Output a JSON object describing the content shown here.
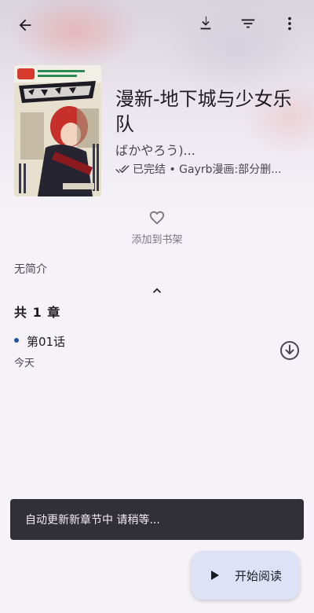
{
  "toolbar": {
    "back_icon": "arrow-back-icon",
    "download_icon": "download-icon",
    "filter_icon": "filter-icon",
    "more_icon": "more-vert-icon"
  },
  "manga": {
    "cover_icon": "manga-cover-image",
    "title": "漫新-地下城与少女乐队",
    "author": "ばかやろう)...",
    "status_icon": "done-all-icon",
    "status_text": "已完结 • Gayrb漫画:部分删..."
  },
  "actions": {
    "favorite_icon": "heart-outline-icon",
    "favorite_label": "添加到书架"
  },
  "description": {
    "text": "无简介",
    "collapse_icon": "chevron-up-icon"
  },
  "chapters": {
    "count_label": "共 1 章",
    "items": [
      {
        "title": "第01话",
        "date": "今天",
        "download_icon": "download-circle-icon"
      }
    ]
  },
  "snackbar": {
    "text": "自动更新新章节中 请稍等..."
  },
  "fab": {
    "icon": "play-icon",
    "label": "开始阅读"
  },
  "colors": {
    "accent": "#1e55a8",
    "fab_bg": "#dde2f7",
    "snackbar_bg": "#313036",
    "background": "#f6f3f8"
  }
}
